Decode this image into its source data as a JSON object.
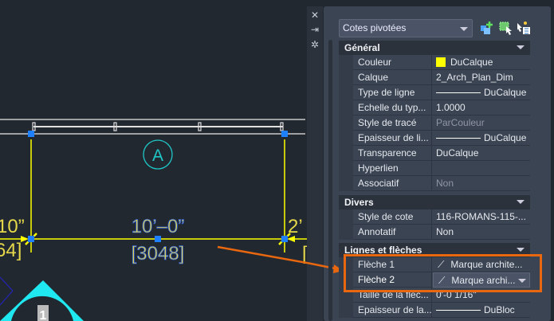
{
  "drawing": {
    "dimension_text": "10’–0”",
    "dimension_alt": "[3048]",
    "grid_bubble": "A",
    "left_dim_text": "10”",
    "left_dim_alt": "64]",
    "right_dim_text": "2’",
    "right_dim_alt": "[",
    "section_marker": "1",
    "colors": {
      "dimension": "#ffff00",
      "grip": "#1e7fff",
      "bubble": "#1fc7c7",
      "arrow": "#e8670f"
    }
  },
  "strip": {
    "icons": [
      "close-icon",
      "auto-hide-icon",
      "settings-icon"
    ]
  },
  "panel": {
    "object_type": "Cotes pivotées",
    "toolbar_icons": [
      "toggle-pickadd-icon",
      "select-objects-icon",
      "quick-select-icon"
    ],
    "sections": [
      {
        "title": "Général",
        "rows": [
          {
            "label": "Couleur",
            "value": "DuCalque",
            "swatch": "#ffff00"
          },
          {
            "label": "Calque",
            "value": "2_Arch_Plan_Dim"
          },
          {
            "label": "Type de ligne",
            "value": "DuCalque",
            "line": true
          },
          {
            "label": "Echelle du typ...",
            "value": "1.0000"
          },
          {
            "label": "Style de tracé",
            "value": "ParCouleur",
            "disabled": true
          },
          {
            "label": "Epaisseur de li...",
            "value": "DuCalque",
            "line": true
          },
          {
            "label": "Transparence",
            "value": "DuCalque"
          },
          {
            "label": "Hyperlien",
            "value": ""
          },
          {
            "label": "Associatif",
            "value": "Non",
            "disabled": true
          }
        ]
      },
      {
        "title": "Divers",
        "rows": [
          {
            "label": "Style de cote",
            "value": "116-ROMANS-115-..."
          },
          {
            "label": "Annotatif",
            "value": "Non"
          }
        ]
      },
      {
        "title": "Lignes et flèches",
        "rows": [
          {
            "label": "Flèche 1",
            "value": "Marque archite..."
          },
          {
            "label": "Flèche 2",
            "value": "Marque archi...",
            "dropdown": true
          },
          {
            "label": "Taille de la flèc...",
            "value": "0'-0 1/16\""
          },
          {
            "label": "Epaisseur de la...",
            "value": "DuBloc",
            "line": true
          }
        ]
      }
    ]
  }
}
